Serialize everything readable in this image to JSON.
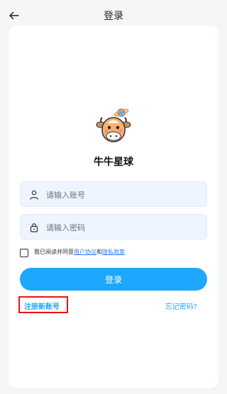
{
  "header": {
    "title": "登录",
    "back_icon": "arrow-left-icon"
  },
  "app": {
    "name": "牛牛星球",
    "logo_icon": "cow-planet-logo"
  },
  "form": {
    "account": {
      "placeholder": "请输入账号",
      "value": "",
      "icon": "user-icon"
    },
    "password": {
      "placeholder": "请输入密码",
      "value": "",
      "icon": "lock-icon"
    },
    "agreement": {
      "prefix": "我已阅读并同意",
      "user_agreement": "用户协议",
      "and": "和",
      "privacy_policy": "隐私政策",
      "checked": false
    },
    "login_label": "登录",
    "register_label": "注册新账号",
    "forgot_label": "忘记密码?"
  },
  "colors": {
    "accent": "#1ea7ff",
    "input_bg": "#eef5ff",
    "highlight": "#e11111",
    "link": "#2f7bff"
  }
}
